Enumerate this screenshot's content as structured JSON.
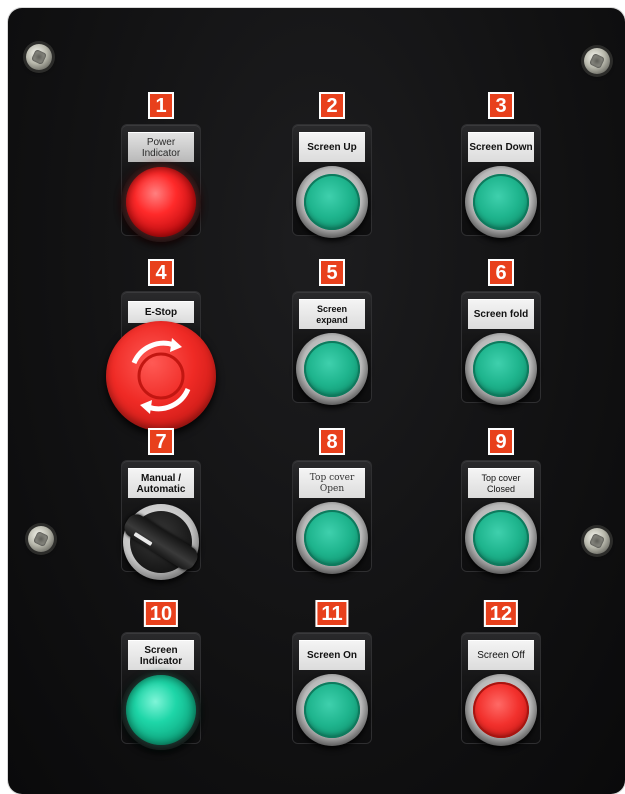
{
  "panel": {
    "buttons": [
      {
        "number": "1",
        "label": "Power\nIndicator",
        "kind": "lamp",
        "color": "#ff2a2a"
      },
      {
        "number": "2",
        "label": "Screen Up",
        "kind": "push",
        "color": "#1fb58e"
      },
      {
        "number": "3",
        "label": "Screen Down",
        "kind": "push",
        "color": "#1fb58e"
      },
      {
        "number": "4",
        "label": "E-Stop",
        "kind": "estop",
        "color": "#ef2a25"
      },
      {
        "number": "5",
        "label": "Screen expand",
        "kind": "push",
        "color": "#1fb58e"
      },
      {
        "number": "6",
        "label": "Screen fold",
        "kind": "push",
        "color": "#1fb58e"
      },
      {
        "number": "7",
        "label": "Manual /\nAutomatic",
        "kind": "selector",
        "color": "#1c1c1c"
      },
      {
        "number": "8",
        "label": "Top cover\nOpen",
        "kind": "push",
        "color": "#1fb58e"
      },
      {
        "number": "9",
        "label": "Top cover\nClosed",
        "kind": "push",
        "color": "#1fb58e"
      },
      {
        "number": "10",
        "label": "Screen\nIndicator",
        "kind": "lamp",
        "color": "#1ed6a8"
      },
      {
        "number": "11",
        "label": "Screen On",
        "kind": "push",
        "color": "#1fb58e"
      },
      {
        "number": "12",
        "label": "Screen Off",
        "kind": "push",
        "color": "#f2312d"
      }
    ],
    "badge_color": "#e8401c",
    "panel_color": "#111112"
  }
}
